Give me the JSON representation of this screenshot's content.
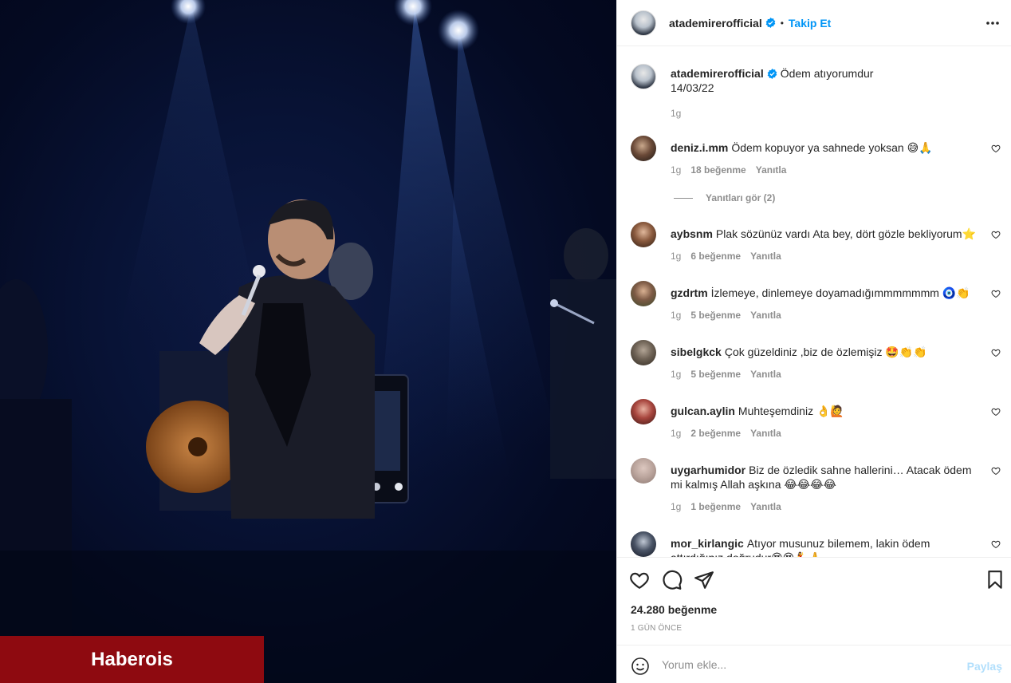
{
  "watermark": "Haberois",
  "header": {
    "username": "atademirerofficial",
    "separator": "•",
    "follow_label": "Takip Et",
    "icons": {
      "verified": "verified-badge-icon",
      "more": "more-options-icon"
    }
  },
  "caption": {
    "username": "atademirerofficial",
    "text": "Ödem atıyorumdur",
    "line2": "14/03/22",
    "age": "1g"
  },
  "comments": [
    {
      "username": "deniz.i.mm",
      "text": "Ödem kopuyor ya sahnede yoksan",
      "emoji": "😅🙏",
      "age": "1g",
      "likes": "18 beğenme",
      "reply": "Yanıtla"
    },
    {
      "username": "aybsnm",
      "text": "Plak sözünüz vardı Ata bey, dört gözle bekliyorum",
      "emoji": "⭐",
      "age": "1g",
      "likes": "6 beğenme",
      "reply": "Yanıtla"
    },
    {
      "username": "gzdrtm",
      "text": "İzlemeye, dinlemeye doyamadığımmmmmmm",
      "emoji": "🧿👏",
      "age": "1g",
      "likes": "5 beğenme",
      "reply": "Yanıtla"
    },
    {
      "username": "sibelgkck",
      "text": "Çok güzeldiniz ,biz de özlemişiz",
      "emoji": "🤩👏👏",
      "age": "1g",
      "likes": "5 beğenme",
      "reply": "Yanıtla"
    },
    {
      "username": "gulcan.aylin",
      "text": "Muhteşemdiniz",
      "emoji": "👌🙋",
      "age": "1g",
      "likes": "2 beğenme",
      "reply": "Yanıtla"
    },
    {
      "username": "uygarhumidor",
      "text": "Biz de özledik sahne hallerini… Atacak ödem mi kalmış Allah aşkına",
      "emoji": "😂😂😂😂",
      "age": "1g",
      "likes": "1 beğenme",
      "reply": "Yanıtla"
    },
    {
      "username": "mor_kirlangic",
      "text": "Atıyor musunuz bilemem, lakin ödem attırdığınız doğrudur",
      "emoji": "😍😍💃🙏",
      "age": "",
      "likes": "",
      "reply": ""
    }
  ],
  "view_replies": "Yanıtları gör (2)",
  "actions": {
    "icons": [
      "heart-icon",
      "comment-icon",
      "share-icon",
      "save-icon"
    ],
    "likes": "24.280 beğenme",
    "time": "1 GÜN ÖNCE"
  },
  "comment_box": {
    "placeholder": "Yorum ekle...",
    "share_label": "Paylaş",
    "icon": "emoji-icon"
  },
  "colors": {
    "accent": "#0095f6",
    "watermark_bg": "#8e0a10",
    "muted": "#8e8e8e"
  }
}
